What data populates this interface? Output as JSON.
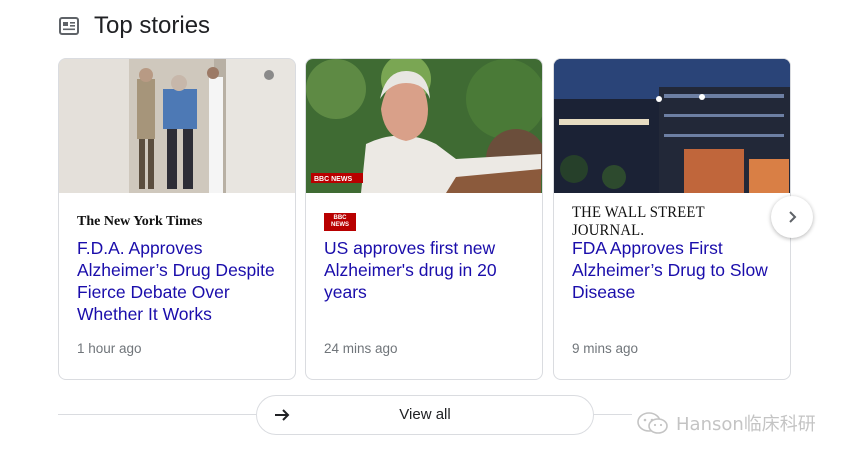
{
  "section": {
    "title": "Top stories",
    "icon": "newspaper-icon"
  },
  "stories": [
    {
      "source": "The New York Times",
      "headline": "F.D.A. Approves Alzheimer’s Drug Despite Fierce Debate Over Whether It Works",
      "time": "1 hour ago"
    },
    {
      "source_badge": [
        "BBC",
        "NEWS"
      ],
      "photo_badge": "BBC NEWS",
      "headline": "US approves first new Alzheimer's drug in 20 years",
      "time": "24 mins ago"
    },
    {
      "source": "THE WALL STREET JOURNAL.",
      "headline": "FDA Approves First Alzheimer’s Drug to Slow Disease",
      "time": "9 mins ago"
    }
  ],
  "next_button_icon": "chevron-right-icon",
  "view_all": {
    "label": "View all",
    "icon": "arrow-right-icon"
  },
  "watermark": "Hanson临床科研",
  "colors": {
    "headline": "#1a0dab",
    "meta": "#70757a",
    "border": "#dadce0",
    "bbc_red": "#b80000"
  }
}
